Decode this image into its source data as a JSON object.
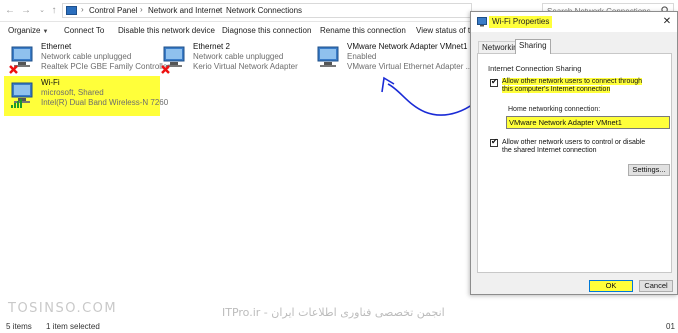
{
  "address": {
    "breadcrumbs": [
      "Control Panel",
      "Network and Internet",
      "Network Connections"
    ],
    "search_placeholder": "Search Network Connections"
  },
  "commands": {
    "organize": "Organize",
    "connect_to": "Connect To",
    "disable": "Disable this network device",
    "diagnose": "Diagnose this connection",
    "rename": "Rename this connection",
    "view_status": "View status of thi"
  },
  "adapters": [
    {
      "name": "Ethernet",
      "status": "Network cable unplugged",
      "device": "Realtek PCIe GBE Family Controller"
    },
    {
      "name": "Ethernet 2",
      "status": "Network cable unplugged",
      "device": "Kerio Virtual Network Adapter"
    },
    {
      "name": "VMware Network Adapter VMnet1",
      "status": "Enabled",
      "device": "VMware Virtual Ethernet Adapter ..."
    },
    {
      "name": "Wi-Fi",
      "status": "microsoft, Shared",
      "device": "Intel(R) Dual Band Wireless-N 7260"
    }
  ],
  "status_bar": {
    "items": "5 items",
    "selected": "1 item selected",
    "page": "01"
  },
  "watermarks": {
    "left": "TOSINSO.COM",
    "middle": "ITPro.ir - انجمن تخصصی فناوری اطلاعات ایران"
  },
  "dialog": {
    "title": "Wi-Fi Properties",
    "close": "✕",
    "tabs": [
      "Networking",
      "Sharing"
    ],
    "group_label": "Internet Connection Sharing",
    "allow_connect": "Allow other network users to connect through this computer's Internet connection",
    "home_label": "Home networking connection:",
    "home_value": "VMware Network Adapter VMnet1",
    "allow_control": "Allow other network users to control or disable the shared Internet connection",
    "settings": "Settings...",
    "ok": "OK",
    "cancel": "Cancel"
  },
  "colors": {
    "highlight": "#ffff3a",
    "annotation": "#1a2bd6",
    "title_icon": "#2a6ebd"
  }
}
